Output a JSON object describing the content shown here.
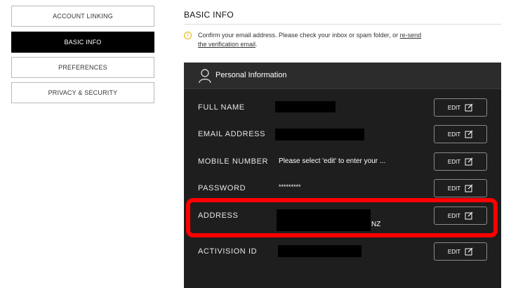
{
  "nav": {
    "items": [
      {
        "label": "ACCOUNT LINKING"
      },
      {
        "label": "BASIC INFO"
      },
      {
        "label": "PREFERENCES"
      },
      {
        "label": "PRIVACY & SECURITY"
      }
    ],
    "active": "BASIC INFO"
  },
  "main": {
    "title": "BASIC INFO",
    "notice": {
      "text": "Confirm your email address. Please check your inbox or spam folder, or",
      "link_part1": "re-send",
      "link_part2": "the verification email",
      "end": "."
    },
    "panel": {
      "title": "Personal Information",
      "rows": [
        {
          "label": "FULL NAME",
          "value": "",
          "edit": "EDIT"
        },
        {
          "label": "EMAIL ADDRESS",
          "value": "",
          "edit": "EDIT"
        },
        {
          "label": "MOBILE NUMBER",
          "value": "Please select 'edit' to enter your ...",
          "edit": "EDIT"
        },
        {
          "label": "PASSWORD",
          "value": "*********",
          "edit": "EDIT"
        },
        {
          "label": "ADDRESS",
          "value": "NZ",
          "edit": "EDIT"
        },
        {
          "label": "ACTIVISION ID",
          "value": "",
          "edit": "EDIT"
        }
      ]
    }
  },
  "colors": {
    "panel_bg": "#1e1e1e",
    "panel_header_bg": "#2c2c2c",
    "active_nav_bg": "#000000",
    "highlight": "#ff0000",
    "warning": "#e5b400"
  }
}
